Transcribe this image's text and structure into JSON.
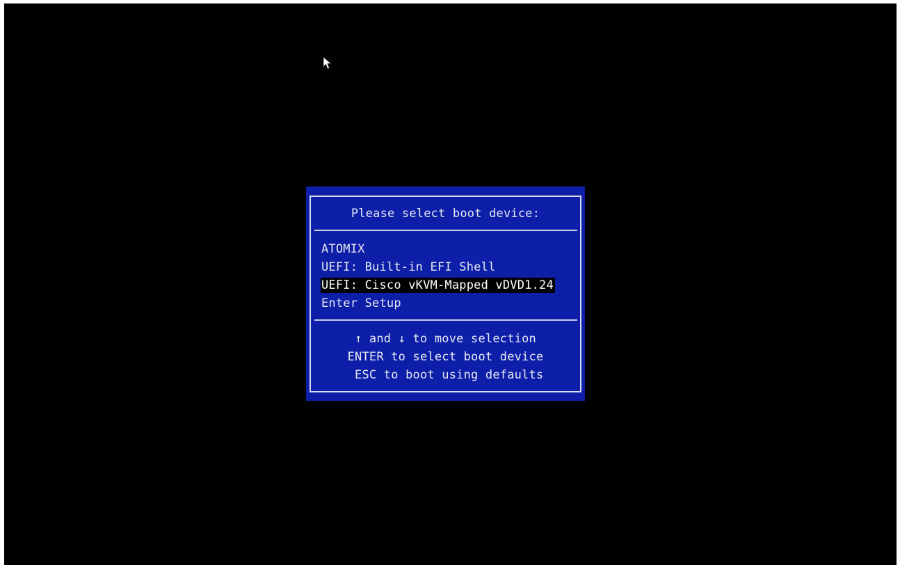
{
  "dialog": {
    "title": "Please select boot device:",
    "options": [
      {
        "label": "ATOMIX",
        "selected": false
      },
      {
        "label": "UEFI: Built-in EFI Shell",
        "selected": false
      },
      {
        "label": "UEFI: Cisco vKVM-Mapped vDVD1.24",
        "selected": true
      },
      {
        "label": "Enter Setup",
        "selected": false
      }
    ],
    "help": [
      "↑ and ↓ to move selection",
      "ENTER to select boot device",
      " ESC to boot using defaults"
    ]
  },
  "colors": {
    "background": "#000000",
    "dialog_background": "#0d1fa8",
    "text": "#e6e8f2",
    "selection_background": "#000000"
  },
  "icons": {
    "cursor": "mouse-pointer-icon"
  }
}
